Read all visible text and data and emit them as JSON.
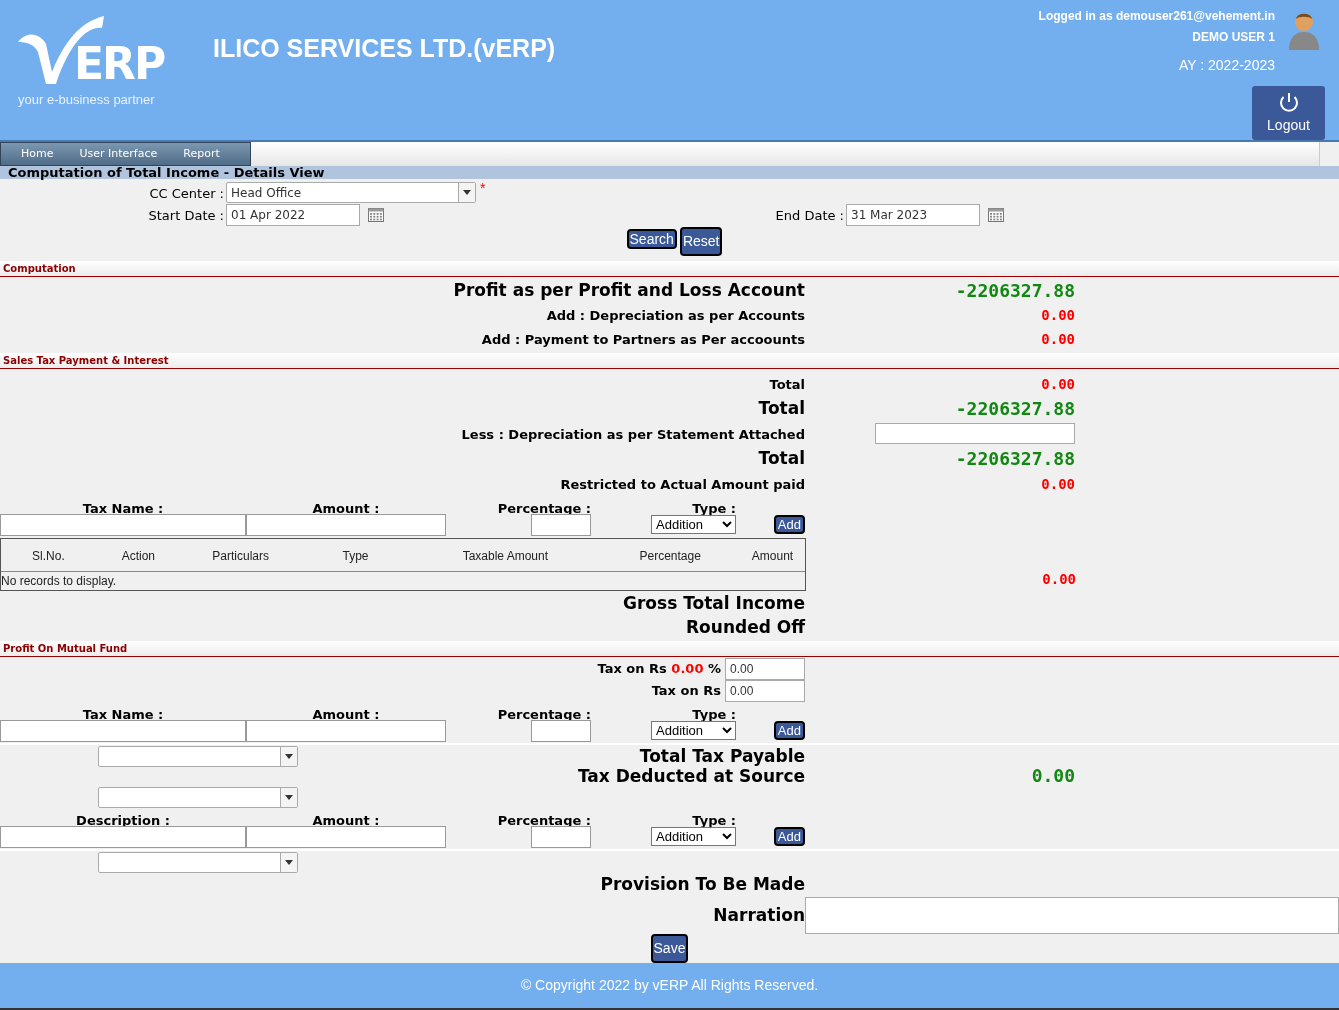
{
  "header": {
    "logo": {
      "text": "ERP",
      "tagline": "your e-business partner"
    },
    "company": "ILICO SERVICES LTD.(vERP)",
    "login": "Logged in as demouser261@vehement.in",
    "user": "DEMO USER 1",
    "year": "AY : 2022-2023",
    "logout": "Logout"
  },
  "menu": [
    "Home",
    "User Interface",
    "Report"
  ],
  "page_title": "Computation of Total Income - Details View",
  "filters": {
    "cc_center": {
      "label": "CC Center :",
      "value": "Head Office",
      "required_mark": "*"
    },
    "start_date": {
      "label": "Start Date :",
      "value": "01 Apr 2022"
    },
    "end_date": {
      "label": "End Date :",
      "value": "31 Mar 2023"
    },
    "buttons": [
      "Search",
      "Reset"
    ]
  },
  "computation": {
    "title": "Computation",
    "rows": [
      {
        "kind": "major",
        "label": "Profit as per Profit and Loss Account",
        "value": "-2206327.88",
        "color": "#118811"
      },
      {
        "kind": "minor",
        "label": "Add : Depreciation as per Accounts",
        "value": "0.00",
        "color": "#ff0000"
      },
      {
        "kind": "minor",
        "label": "Add : Payment to Partners as Per accoounts",
        "value": "0.00",
        "color": "#ff0000"
      }
    ]
  },
  "sales_tax": {
    "title": "Sales Tax Payment & Interest",
    "rows": [
      {
        "kind": "minor",
        "label": "Total",
        "value": "0.00",
        "color": "#ff0000"
      },
      {
        "kind": "major",
        "label": "Total",
        "value": "-2206327.88",
        "color": "#118811"
      },
      {
        "kind": "input",
        "label": "Less : Depreciation as per Statement Attached"
      },
      {
        "kind": "major",
        "label": "Total",
        "value": "-2206327.88",
        "color": "#118811"
      },
      {
        "kind": "minor",
        "label": "Restricted to Actual Amount paid",
        "value": "0.00",
        "color": "#ff0000"
      }
    ],
    "entry": {
      "labels": [
        "Tax Name :",
        "Amount :",
        "Percentage :",
        "Type :"
      ],
      "type": "Addition",
      "button": "Add"
    },
    "table": {
      "columns": [
        "Sl.No.",
        "Action",
        "Particulars",
        "Type",
        "Taxable Amount",
        "Percentage",
        "Amount"
      ],
      "empty_text": "No records to display.",
      "total": "0.00"
    },
    "closing_rows": [
      {
        "kind": "major",
        "label": "Gross Total Income"
      },
      {
        "kind": "major",
        "label": "Rounded Off"
      }
    ]
  },
  "mutual_fund": {
    "title": "Profit On Mutual Fund",
    "tax_rate": {
      "label": "Tax on Rs",
      "amount": "0.00",
      "unit": "%",
      "value": "0.00"
    },
    "tax_amount": {
      "label": "Tax on Rs",
      "value": "0.00"
    },
    "entry": {
      "labels": [
        "Tax Name :",
        "Amount :",
        "Percentage :",
        "Type :"
      ],
      "type": "Addition",
      "button": "Add"
    },
    "summary_rows": [
      {
        "label": "Total Tax Payable"
      },
      {
        "label": "Tax Deducted at Source",
        "value": "0.00",
        "color": "#118811"
      }
    ],
    "description_entry": {
      "labels": [
        "Description :",
        "Amount :",
        "Percentage :",
        "Type :"
      ],
      "type": "Addition",
      "button": "Add"
    },
    "provision": "Provision To Be Made",
    "narration": "Narration",
    "save": "Save"
  },
  "footer": "© Copyright 2022 by vERP All Rights Reserved."
}
